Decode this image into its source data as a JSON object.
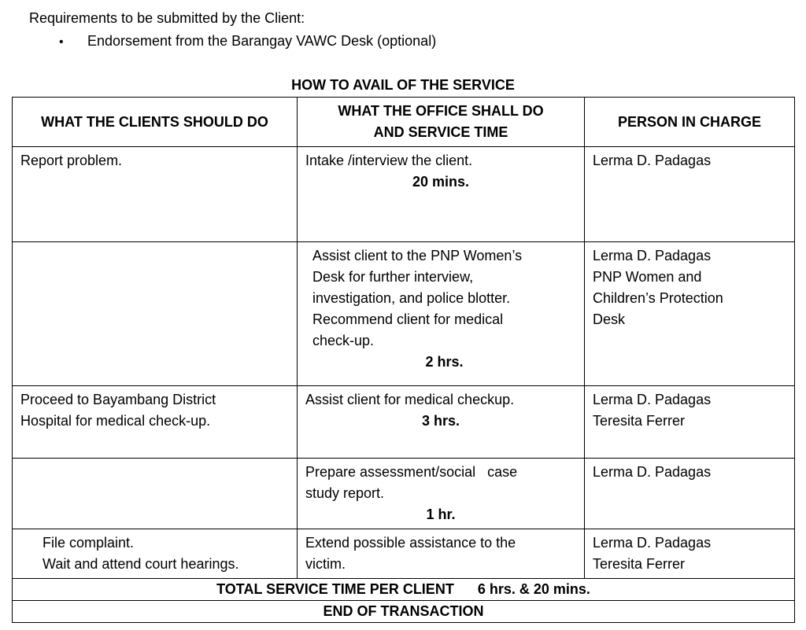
{
  "requirements": {
    "title": "Requirements to be submitted by the Client:",
    "bullet": "•",
    "items": [
      "Endorsement from the Barangay VAWC Desk (optional)"
    ]
  },
  "section_title": "HOW TO AVAIL OF THE SERVICE",
  "table": {
    "headers": {
      "clients": "WHAT THE CLIENTS SHOULD DO",
      "office_line1": "WHAT THE OFFICE SHALL DO",
      "office_line2": "AND SERVICE TIME",
      "person": "PERSON IN CHARGE"
    },
    "rows": [
      {
        "client": [
          "Report problem."
        ],
        "office": [
          "Intake /interview the client."
        ],
        "time": "20 mins.",
        "person": [
          "Lerma D. Padagas"
        ]
      },
      {
        "client": [],
        "office": [
          "Assist client to the PNP Women’s",
          "Desk for further interview,",
          "investigation, and police blotter.",
          "Recommend client for medical",
          "check-up."
        ],
        "time": "2 hrs.",
        "person": [
          "Lerma D. Padagas",
          "PNP Women and",
          "Children’s Protection",
          "Desk"
        ]
      },
      {
        "client": [
          "Proceed to Bayambang District",
          "Hospital for medical check-up."
        ],
        "office": [
          "Assist client for medical checkup."
        ],
        "time": "3 hrs.",
        "person": [
          "Lerma D. Padagas",
          "Teresita Ferrer"
        ]
      },
      {
        "client": [],
        "office": [
          "Prepare assessment/social   case",
          "study report."
        ],
        "time": "1 hr.",
        "person": [
          "Lerma D. Padagas"
        ]
      },
      {
        "client": [
          "File complaint.",
          "Wait and attend court hearings."
        ],
        "office": [
          "Extend possible assistance to the",
          "victim."
        ],
        "time": "",
        "person": [
          "Lerma D. Padagas",
          "Teresita Ferrer"
        ]
      }
    ],
    "total_label": "TOTAL SERVICE TIME PER CLIENT",
    "total_value": "6 hrs. & 20 mins.",
    "end_label": "END OF TRANSACTION"
  }
}
